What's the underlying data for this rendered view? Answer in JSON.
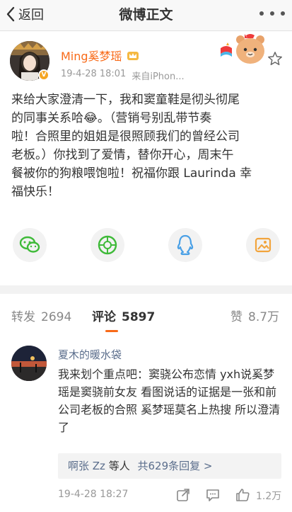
{
  "nav": {
    "back_label": "返回",
    "title": "微博正文"
  },
  "post": {
    "username": "Ming奚梦瑶",
    "time": "19-4-28 18:01",
    "source": "来自iPhon...",
    "body": "来给大家澄清一下，我和窦童鞋是彻头彻尾\n的同事关系哈😂。（营销号别乱带节奏\n啦！合照里的姐姐是很照顾我们的曾经公司\n老板。）你找到了爱情，替你开心，周末午\n餐被你的狗粮喂饱啦！祝福你跟 Laurinda 幸\n福快乐！"
  },
  "share_icons": [
    "wechat-icon",
    "moments-icon",
    "qq-icon",
    "save-image-icon"
  ],
  "tabs": {
    "repost_label": "转发",
    "repost_count": "2694",
    "comment_label": "评论",
    "comment_count": "5897",
    "like_label": "赞",
    "like_count": "8.7万"
  },
  "comment": {
    "username": "夏木的暖水袋",
    "text": "我来划个重点吧：窦骁公布恋情 yxh说奚梦瑶是窦骁前女友 看图说话的证据是一张和前公司老板的合照 奚梦瑶莫名上热搜 所以澄清了",
    "reply_user": "啊张 Zz",
    "reply_mid": "等人",
    "reply_more": "共629条回复 >",
    "time": "19-4-28 18:27",
    "like_count": "1.2万"
  },
  "colors": {
    "accent": "#f86a18",
    "link": "#5b6e8c",
    "share_green": "#3fba39",
    "share_blue": "#4aa0e6",
    "share_orange": "#f2a43c"
  }
}
